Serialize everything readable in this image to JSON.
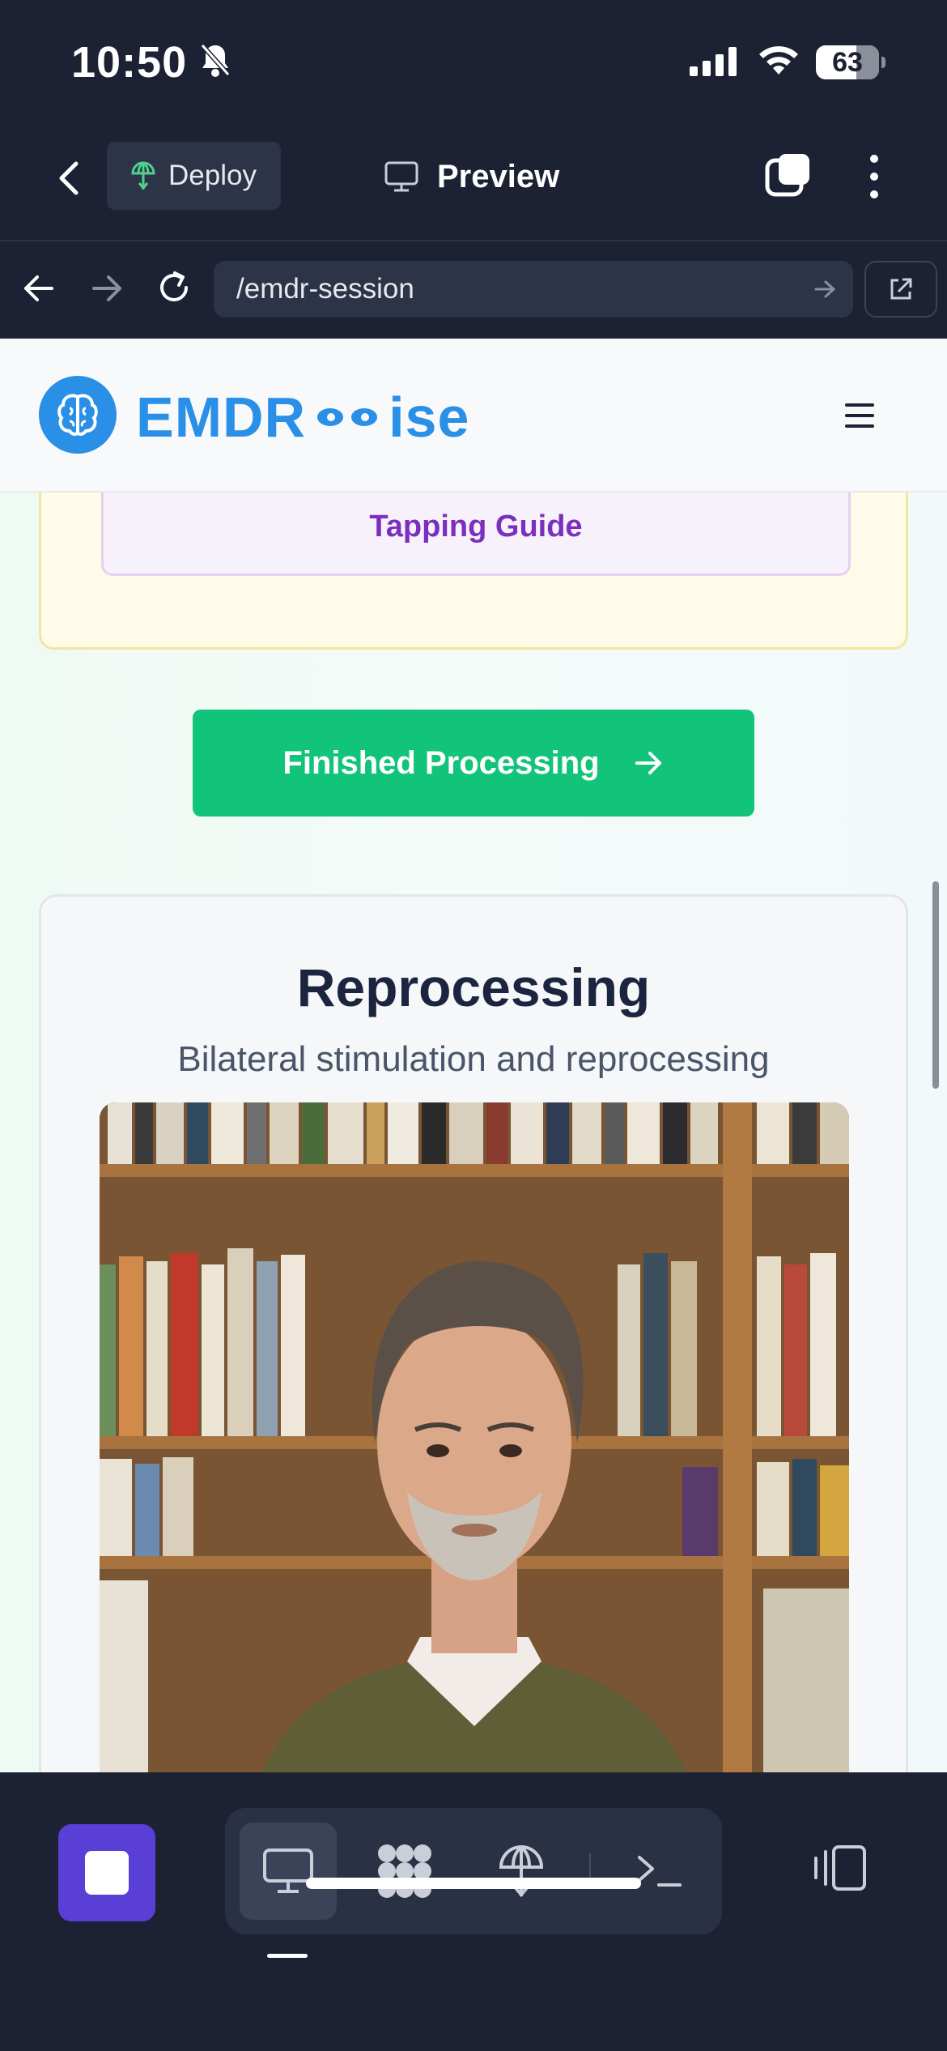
{
  "status_bar": {
    "time": "10:50",
    "battery": "63",
    "icons": [
      "bell-slash-icon",
      "signal-icon",
      "wifi-icon",
      "battery-icon"
    ]
  },
  "app_header": {
    "deploy_label": "Deploy",
    "preview_label": "Preview"
  },
  "browser": {
    "url": "/emdr-session"
  },
  "site": {
    "logo_prefix": "EMDR",
    "logo_suffix": "ise",
    "card_text": "Tapping Guide"
  },
  "actions": {
    "finish_label": "Finished Processing"
  },
  "reprocessing": {
    "title": "Reprocessing",
    "subtitle": "Bilateral stimulation and reprocessing"
  },
  "colors": {
    "app_dark": "#1c2233",
    "accent_blue": "#2a8fe6",
    "success_green": "#11c47a",
    "stop_purple": "#5a3fd6"
  }
}
